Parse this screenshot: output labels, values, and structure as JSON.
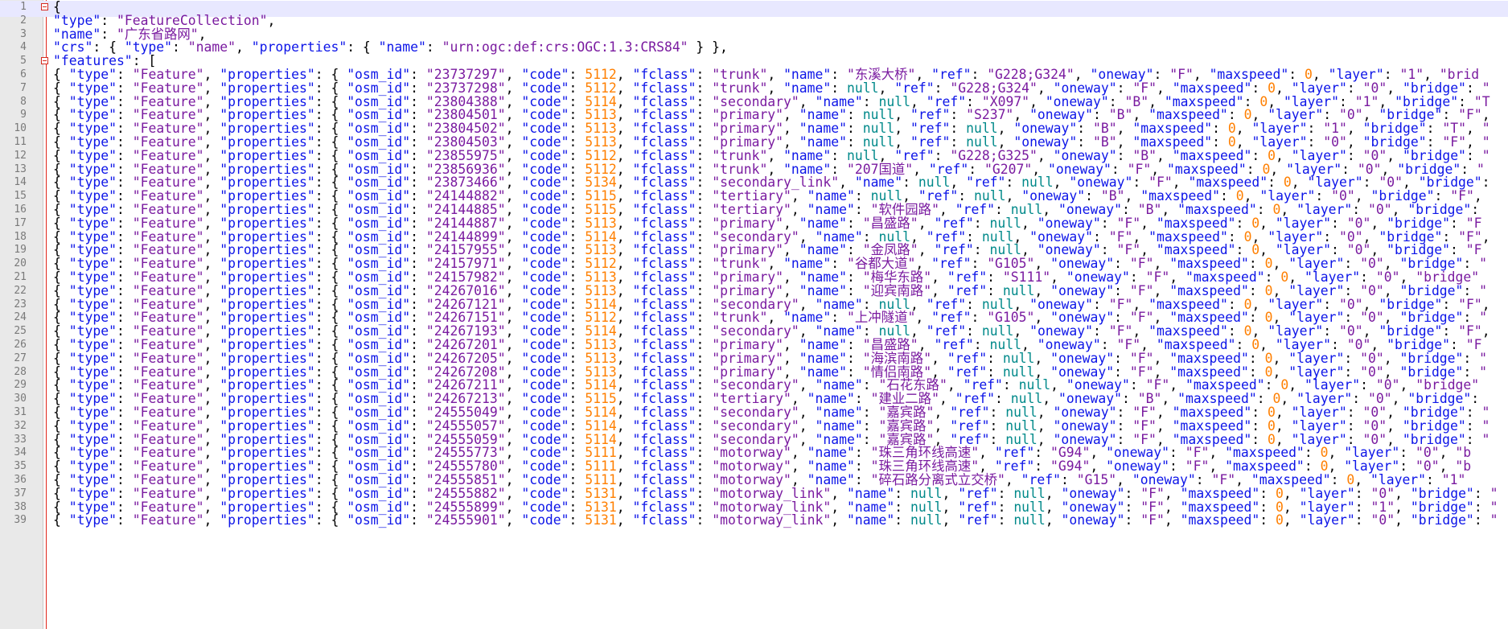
{
  "editor": {
    "colors": {
      "key": "#0d15e8",
      "string": "#7a1ba0",
      "number": "#ff7f00",
      "null": "#00898a",
      "fold_marker": "#d62a1e",
      "current_line": "#e8e8ff",
      "gutter": "#e9e9e9"
    },
    "current_line": 1,
    "fold_markers": [
      1,
      5
    ],
    "lines": [
      "{",
      "\"type\": \"FeatureCollection\",",
      "\"name\": \"广东省路网\",",
      "\"crs\": { \"type\": \"name\", \"properties\": { \"name\": \"urn:ogc:def:crs:OGC:1.3:CRS84\" } },",
      "\"features\": [",
      "{ \"type\": \"Feature\", \"properties\": { \"osm_id\": \"23737297\", \"code\": 5112, \"fclass\": \"trunk\", \"name\": \"东溪大桥\", \"ref\": \"G228;G324\", \"oneway\": \"F\", \"maxspeed\": 0, \"layer\": \"1\", \"brid",
      "{ \"type\": \"Feature\", \"properties\": { \"osm_id\": \"23737298\", \"code\": 5112, \"fclass\": \"trunk\", \"name\": null, \"ref\": \"G228;G324\", \"oneway\": \"F\", \"maxspeed\": 0, \"layer\": \"0\", \"bridge\": \"",
      "{ \"type\": \"Feature\", \"properties\": { \"osm_id\": \"23804388\", \"code\": 5114, \"fclass\": \"secondary\", \"name\": null, \"ref\": \"X097\", \"oneway\": \"B\", \"maxspeed\": 0, \"layer\": \"1\", \"bridge\": \"T",
      "{ \"type\": \"Feature\", \"properties\": { \"osm_id\": \"23804501\", \"code\": 5113, \"fclass\": \"primary\", \"name\": null, \"ref\": \"S237\", \"oneway\": \"B\", \"maxspeed\": 0, \"layer\": \"0\", \"bridge\": \"F\",",
      "{ \"type\": \"Feature\", \"properties\": { \"osm_id\": \"23804502\", \"code\": 5113, \"fclass\": \"primary\", \"name\": null, \"ref\": null, \"oneway\": \"B\", \"maxspeed\": 0, \"layer\": \"1\", \"bridge\": \"T\", \"",
      "{ \"type\": \"Feature\", \"properties\": { \"osm_id\": \"23804503\", \"code\": 5113, \"fclass\": \"primary\", \"name\": null, \"ref\": null, \"oneway\": \"B\", \"maxspeed\": 0, \"layer\": \"0\", \"bridge\": \"F\", \"",
      "{ \"type\": \"Feature\", \"properties\": { \"osm_id\": \"23855975\", \"code\": 5112, \"fclass\": \"trunk\", \"name\": null, \"ref\": \"G228;G325\", \"oneway\": \"B\", \"maxspeed\": 0, \"layer\": \"0\", \"bridge\": \"",
      "{ \"type\": \"Feature\", \"properties\": { \"osm_id\": \"23856936\", \"code\": 5112, \"fclass\": \"trunk\", \"name\": \"207国道\", \"ref\": \"G207\", \"oneway\": \"F\", \"maxspeed\": 0, \"layer\": \"0\", \"bridge\": \"",
      "{ \"type\": \"Feature\", \"properties\": { \"osm_id\": \"23873466\", \"code\": 5134, \"fclass\": \"secondary_link\", \"name\": null, \"ref\": null, \"oneway\": \"F\", \"maxspeed\": 0, \"layer\": \"0\", \"bridge\":",
      "{ \"type\": \"Feature\", \"properties\": { \"osm_id\": \"24144882\", \"code\": 5115, \"fclass\": \"tertiary\", \"name\": null, \"ref\": null, \"oneway\": \"B\", \"maxspeed\": 0, \"layer\": \"0\", \"bridge\": \"F\",",
      "{ \"type\": \"Feature\", \"properties\": { \"osm_id\": \"24144885\", \"code\": 5115, \"fclass\": \"tertiary\", \"name\": \"软件园路\", \"ref\": null, \"oneway\": \"B\", \"maxspeed\": 0, \"layer\": \"0\", \"bridge\":",
      "{ \"type\": \"Feature\", \"properties\": { \"osm_id\": \"24144887\", \"code\": 5113, \"fclass\": \"primary\", \"name\": \"昌盛路\", \"ref\": null, \"oneway\": \"F\", \"maxspeed\": 0, \"layer\": \"0\", \"bridge\": \"F",
      "{ \"type\": \"Feature\", \"properties\": { \"osm_id\": \"24144899\", \"code\": 5114, \"fclass\": \"secondary\", \"name\": null, \"ref\": null, \"oneway\": \"F\", \"maxspeed\": 0, \"layer\": \"0\", \"bridge\": \"F\",",
      "{ \"type\": \"Feature\", \"properties\": { \"osm_id\": \"24157955\", \"code\": 5113, \"fclass\": \"primary\", \"name\": \"金凤路\", \"ref\": null, \"oneway\": \"F\", \"maxspeed\": 0, \"layer\": \"0\", \"bridge\": \"F",
      "{ \"type\": \"Feature\", \"properties\": { \"osm_id\": \"24157971\", \"code\": 5112, \"fclass\": \"trunk\", \"name\": \"谷都大道\", \"ref\": \"G105\", \"oneway\": \"F\", \"maxspeed\": 0, \"layer\": \"0\", \"bridge\": \"",
      "{ \"type\": \"Feature\", \"properties\": { \"osm_id\": \"24157982\", \"code\": 5113, \"fclass\": \"primary\", \"name\": \"梅华东路\", \"ref\": \"S111\", \"oneway\": \"F\", \"maxspeed\": 0, \"layer\": \"0\", \"bridge\"",
      "{ \"type\": \"Feature\", \"properties\": { \"osm_id\": \"24267016\", \"code\": 5113, \"fclass\": \"primary\", \"name\": \"迎宾南路\", \"ref\": null, \"oneway\": \"F\", \"maxspeed\": 0, \"layer\": \"0\", \"bridge\": \"",
      "{ \"type\": \"Feature\", \"properties\": { \"osm_id\": \"24267121\", \"code\": 5114, \"fclass\": \"secondary\", \"name\": null, \"ref\": null, \"oneway\": \"F\", \"maxspeed\": 0, \"layer\": \"0\", \"bridge\": \"F\",",
      "{ \"type\": \"Feature\", \"properties\": { \"osm_id\": \"24267151\", \"code\": 5112, \"fclass\": \"trunk\", \"name\": \"上冲隧道\", \"ref\": \"G105\", \"oneway\": \"F\", \"maxspeed\": 0, \"layer\": \"0\", \"bridge\": \"",
      "{ \"type\": \"Feature\", \"properties\": { \"osm_id\": \"24267193\", \"code\": 5114, \"fclass\": \"secondary\", \"name\": null, \"ref\": null, \"oneway\": \"F\", \"maxspeed\": 0, \"layer\": \"0\", \"bridge\": \"F\",",
      "{ \"type\": \"Feature\", \"properties\": { \"osm_id\": \"24267201\", \"code\": 5113, \"fclass\": \"primary\", \"name\": \"昌盛路\", \"ref\": null, \"oneway\": \"F\", \"maxspeed\": 0, \"layer\": \"0\", \"bridge\": \"F",
      "{ \"type\": \"Feature\", \"properties\": { \"osm_id\": \"24267205\", \"code\": 5113, \"fclass\": \"primary\", \"name\": \"海滨南路\", \"ref\": null, \"oneway\": \"F\", \"maxspeed\": 0, \"layer\": \"0\", \"bridge\": \"",
      "{ \"type\": \"Feature\", \"properties\": { \"osm_id\": \"24267208\", \"code\": 5113, \"fclass\": \"primary\", \"name\": \"情侣南路\", \"ref\": null, \"oneway\": \"F\", \"maxspeed\": 0, \"layer\": \"0\", \"bridge\": \"",
      "{ \"type\": \"Feature\", \"properties\": { \"osm_id\": \"24267211\", \"code\": 5114, \"fclass\": \"secondary\", \"name\": \"石花东路\", \"ref\": null, \"oneway\": \"F\", \"maxspeed\": 0, \"layer\": \"0\", \"bridge\"",
      "{ \"type\": \"Feature\", \"properties\": { \"osm_id\": \"24267213\", \"code\": 5115, \"fclass\": \"tertiary\", \"name\": \"建业二路\", \"ref\": null, \"oneway\": \"B\", \"maxspeed\": 0, \"layer\": \"0\", \"bridge\":",
      "{ \"type\": \"Feature\", \"properties\": { \"osm_id\": \"24555049\", \"code\": 5114, \"fclass\": \"secondary\", \"name\": \"嘉宾路\", \"ref\": null, \"oneway\": \"F\", \"maxspeed\": 0, \"layer\": \"0\", \"bridge\": \"",
      "{ \"type\": \"Feature\", \"properties\": { \"osm_id\": \"24555057\", \"code\": 5114, \"fclass\": \"secondary\", \"name\": \"嘉宾路\", \"ref\": null, \"oneway\": \"F\", \"maxspeed\": 0, \"layer\": \"0\", \"bridge\": \"",
      "{ \"type\": \"Feature\", \"properties\": { \"osm_id\": \"24555059\", \"code\": 5114, \"fclass\": \"secondary\", \"name\": \"嘉宾路\", \"ref\": null, \"oneway\": \"F\", \"maxspeed\": 0, \"layer\": \"0\", \"bridge\": \"",
      "{ \"type\": \"Feature\", \"properties\": { \"osm_id\": \"24555773\", \"code\": 5111, \"fclass\": \"motorway\", \"name\": \"珠三角环线高速\", \"ref\": \"G94\", \"oneway\": \"F\", \"maxspeed\": 0, \"layer\": \"0\", \"b",
      "{ \"type\": \"Feature\", \"properties\": { \"osm_id\": \"24555780\", \"code\": 5111, \"fclass\": \"motorway\", \"name\": \"珠三角环线高速\", \"ref\": \"G94\", \"oneway\": \"F\", \"maxspeed\": 0, \"layer\": \"0\", \"b",
      "{ \"type\": \"Feature\", \"properties\": { \"osm_id\": \"24555851\", \"code\": 5111, \"fclass\": \"motorway\", \"name\": \"碎石路分离式立交桥\", \"ref\": \"G15\", \"oneway\": \"F\", \"maxspeed\": 0, \"layer\": \"1\"",
      "{ \"type\": \"Feature\", \"properties\": { \"osm_id\": \"24555882\", \"code\": 5131, \"fclass\": \"motorway_link\", \"name\": null, \"ref\": null, \"oneway\": \"F\", \"maxspeed\": 0, \"layer\": \"0\", \"bridge\": \"",
      "{ \"type\": \"Feature\", \"properties\": { \"osm_id\": \"24555899\", \"code\": 5131, \"fclass\": \"motorway_link\", \"name\": null, \"ref\": null, \"oneway\": \"F\", \"maxspeed\": 0, \"layer\": \"1\", \"bridge\": \"",
      "{ \"type\": \"Feature\", \"properties\": { \"osm_id\": \"24555901\", \"code\": 5131, \"fclass\": \"motorway_link\", \"name\": null, \"ref\": null, \"oneway\": \"F\", \"maxspeed\": 0, \"layer\": \"0\", \"bridge\": \""
    ]
  }
}
